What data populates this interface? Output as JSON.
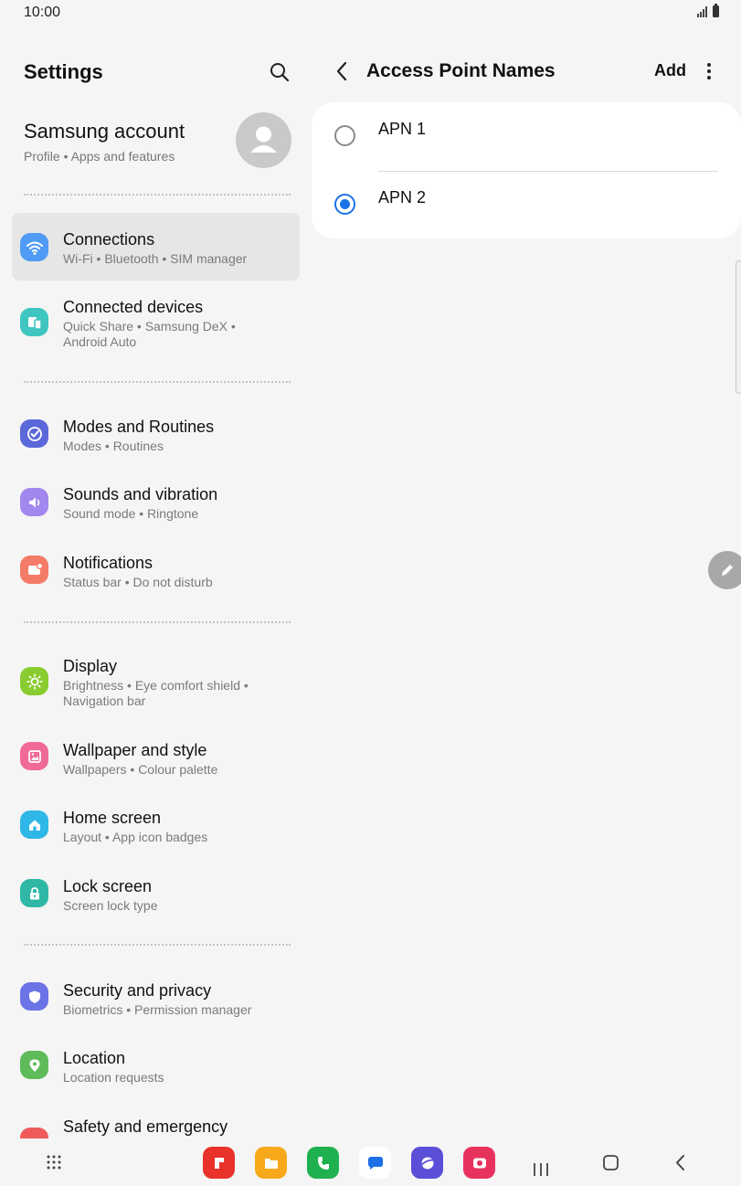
{
  "status_bar": {
    "time": "10:00"
  },
  "settings": {
    "title": "Settings",
    "account": {
      "name": "Samsung account",
      "subtitle": "Profile  •  Apps and features"
    },
    "items": [
      {
        "title": "Connections",
        "subtitle": "Wi-Fi  •  Bluetooth  •  SIM manager",
        "icon": "wifi-icon",
        "color": "#4f9bf5",
        "selected": true
      },
      {
        "title": "Connected devices",
        "subtitle": "Quick Share  •  Samsung DeX  •",
        "subtitle2": "Android Auto",
        "icon": "connected-devices-icon",
        "color": "#3fc6c0"
      },
      {
        "title": "Modes and Routines",
        "subtitle": "Modes  •  Routines",
        "icon": "modes-icon",
        "color": "#5b68d9"
      },
      {
        "title": "Sounds and vibration",
        "subtitle": "Sound mode  •  Ringtone",
        "icon": "speaker-icon",
        "color": "#a187ee"
      },
      {
        "title": "Notifications",
        "subtitle": "Status bar  •  Do not disturb",
        "icon": "notification-icon",
        "color": "#f47b68"
      },
      {
        "title": "Display",
        "subtitle": "Brightness  •  Eye comfort shield  •",
        "subtitle2": "Navigation bar",
        "icon": "sun-icon",
        "color": "#88cc2f"
      },
      {
        "title": "Wallpaper and style",
        "subtitle": "Wallpapers  •  Colour palette",
        "icon": "wallpaper-icon",
        "color": "#ef6a95"
      },
      {
        "title": "Home screen",
        "subtitle": "Layout  •  App icon badges",
        "icon": "home-icon",
        "color": "#2fb7e8"
      },
      {
        "title": "Lock screen",
        "subtitle": "Screen lock type",
        "icon": "lock-icon",
        "color": "#2fb8a5"
      },
      {
        "title": "Security and privacy",
        "subtitle": "Biometrics  •  Permission manager",
        "icon": "shield-icon",
        "color": "#6b73e6"
      },
      {
        "title": "Location",
        "subtitle": "Location requests",
        "icon": "location-icon",
        "color": "#5fbb5a"
      },
      {
        "title": "Safety and emergency",
        "subtitle": "",
        "icon": "emergency-icon",
        "color": "#ef5a5a"
      }
    ]
  },
  "apn": {
    "title": "Access Point Names",
    "add_label": "Add",
    "entries": [
      {
        "label": "APN 1",
        "selected": false
      },
      {
        "label": "APN 2",
        "selected": true
      }
    ],
    "accent": "#1a73e8"
  },
  "navbar": {
    "apps": [
      {
        "name": "flipboard-app-icon",
        "color": "#e8322a"
      },
      {
        "name": "my-files-app-icon",
        "color": "#f7a91b"
      },
      {
        "name": "phone-app-icon",
        "color": "#1fb14f"
      },
      {
        "name": "messages-app-icon",
        "color": "#ffffff"
      },
      {
        "name": "internet-app-icon",
        "color": "#5b4fd8"
      },
      {
        "name": "camera-app-icon",
        "color": "#e8325e"
      }
    ]
  }
}
